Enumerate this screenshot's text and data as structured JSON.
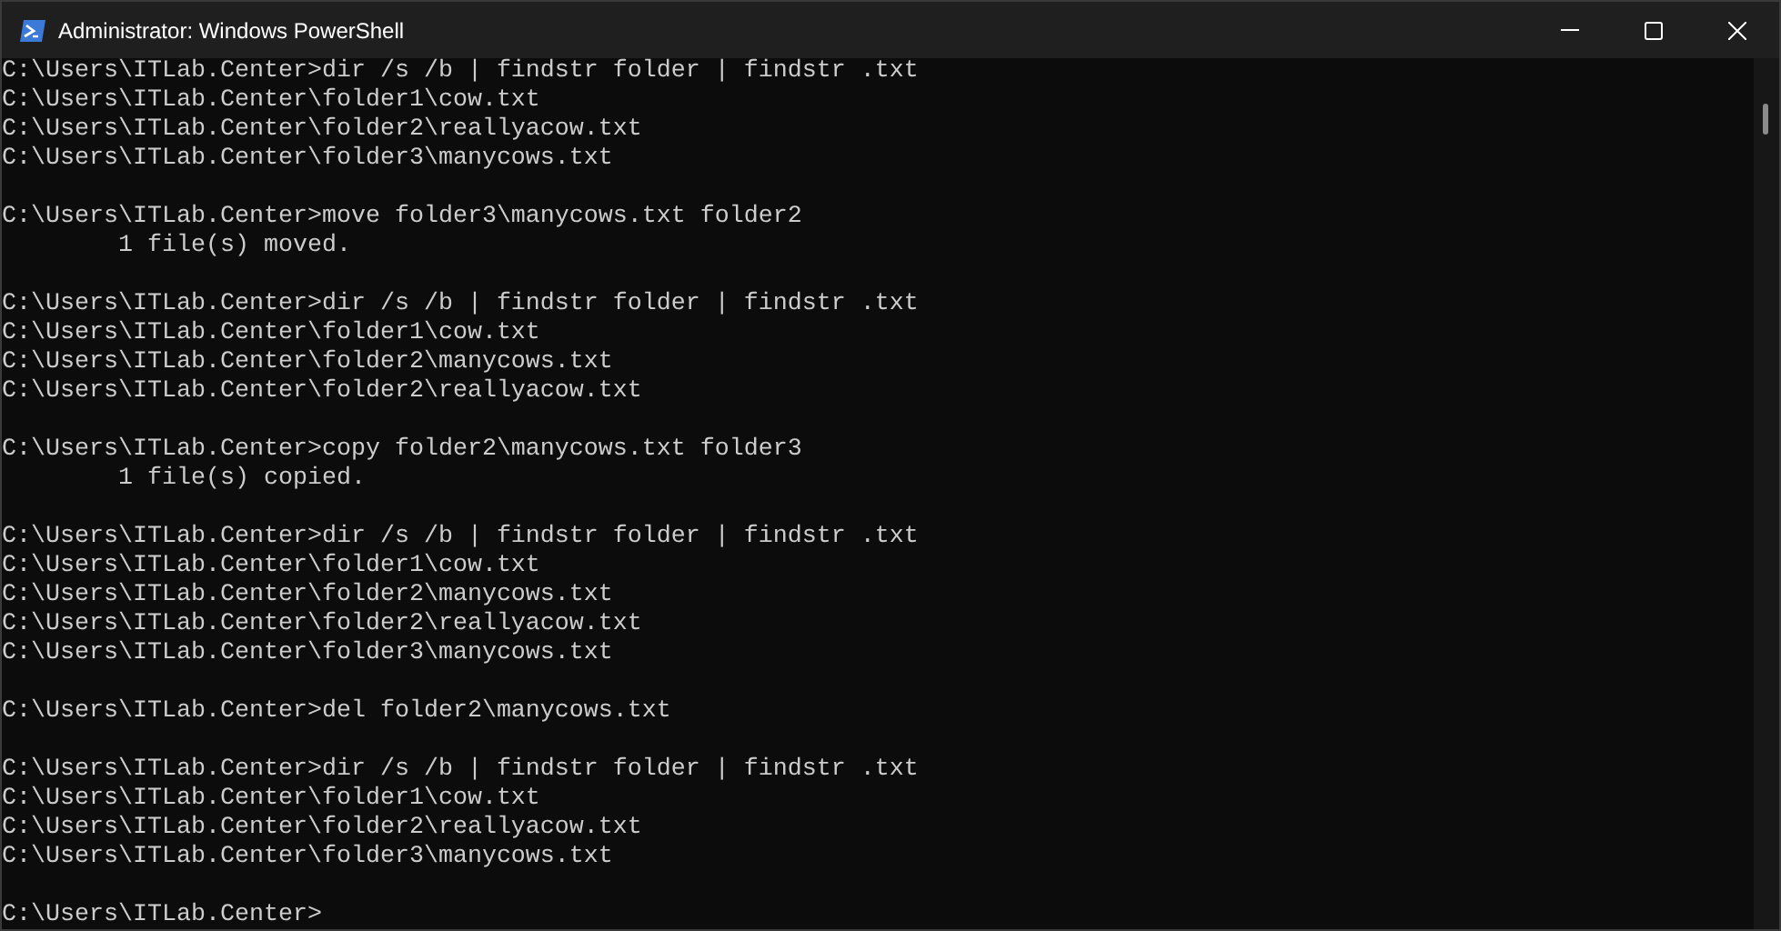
{
  "window": {
    "title": "Administrator: Windows PowerShell"
  },
  "console": {
    "blocks": [
      [
        "C:\\Users\\ITLab.Center>dir /s /b | findstr folder | findstr .txt",
        "C:\\Users\\ITLab.Center\\folder1\\cow.txt",
        "C:\\Users\\ITLab.Center\\folder2\\reallyacow.txt",
        "C:\\Users\\ITLab.Center\\folder3\\manycows.txt"
      ],
      [
        "C:\\Users\\ITLab.Center>move folder3\\manycows.txt folder2",
        "        1 file(s) moved."
      ],
      [
        "C:\\Users\\ITLab.Center>dir /s /b | findstr folder | findstr .txt",
        "C:\\Users\\ITLab.Center\\folder1\\cow.txt",
        "C:\\Users\\ITLab.Center\\folder2\\manycows.txt",
        "C:\\Users\\ITLab.Center\\folder2\\reallyacow.txt"
      ],
      [
        "C:\\Users\\ITLab.Center>copy folder2\\manycows.txt folder3",
        "        1 file(s) copied."
      ],
      [
        "C:\\Users\\ITLab.Center>dir /s /b | findstr folder | findstr .txt",
        "C:\\Users\\ITLab.Center\\folder1\\cow.txt",
        "C:\\Users\\ITLab.Center\\folder2\\manycows.txt",
        "C:\\Users\\ITLab.Center\\folder2\\reallyacow.txt",
        "C:\\Users\\ITLab.Center\\folder3\\manycows.txt"
      ],
      [
        "C:\\Users\\ITLab.Center>del folder2\\manycows.txt"
      ],
      [
        "C:\\Users\\ITLab.Center>dir /s /b | findstr folder | findstr .txt",
        "C:\\Users\\ITLab.Center\\folder1\\cow.txt",
        "C:\\Users\\ITLab.Center\\folder2\\reallyacow.txt",
        "C:\\Users\\ITLab.Center\\folder3\\manycows.txt"
      ],
      [
        "C:\\Users\\ITLab.Center>"
      ]
    ]
  }
}
